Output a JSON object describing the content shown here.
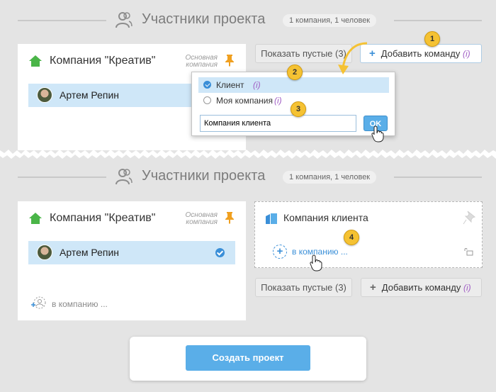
{
  "top": {
    "section_title": "Участники проекта",
    "section_badge": "1 компания, 1 человек",
    "company": {
      "name": "Компания \"Креатив\"",
      "primary_label_line1": "Основная",
      "primary_label_line2": "компания",
      "member": "Артем Репин"
    },
    "show_empty_label": "Показать пустые (3)",
    "add_team_label": "Добавить команду",
    "add_team_info": "(i)",
    "popup": {
      "option_client": "Клиент",
      "option_client_info": "(i)",
      "option_my_company": "Моя компания",
      "option_my_company_info": "(i)",
      "input_value": "Компания клиента",
      "ok_label": "OK"
    },
    "steps": [
      "1",
      "2",
      "3"
    ]
  },
  "bottom": {
    "section_title": "Участники проекта",
    "section_badge": "1 компания, 1 человек",
    "company": {
      "name": "Компания \"Креатив\"",
      "primary_label_line1": "Основная",
      "primary_label_line2": "компания",
      "member": "Артем Репин",
      "add_to_company": "в компанию ..."
    },
    "new_company": {
      "name": "Компания клиента",
      "add_to_company": "в компанию ..."
    },
    "show_empty_label": "Показать пустые (3)",
    "add_team_label": "Добавить команду",
    "add_team_info": "(i)",
    "step": "4",
    "create_project_label": "Создать проект"
  },
  "colors": {
    "accent": "#3a8fd8",
    "button_blue": "#5aaee8",
    "selected_row": "#cfe7f8",
    "step_marker": "#f5c233",
    "home_icon": "#4ab548",
    "pin_icon": "#f0a020",
    "info": "#a05ec4"
  },
  "icons": [
    "users-icon",
    "home-icon",
    "pin-icon",
    "plus-icon",
    "radio-icon",
    "building-icon",
    "lock-icon",
    "hand-cursor-icon",
    "check-icon",
    "arrow-icon"
  ]
}
